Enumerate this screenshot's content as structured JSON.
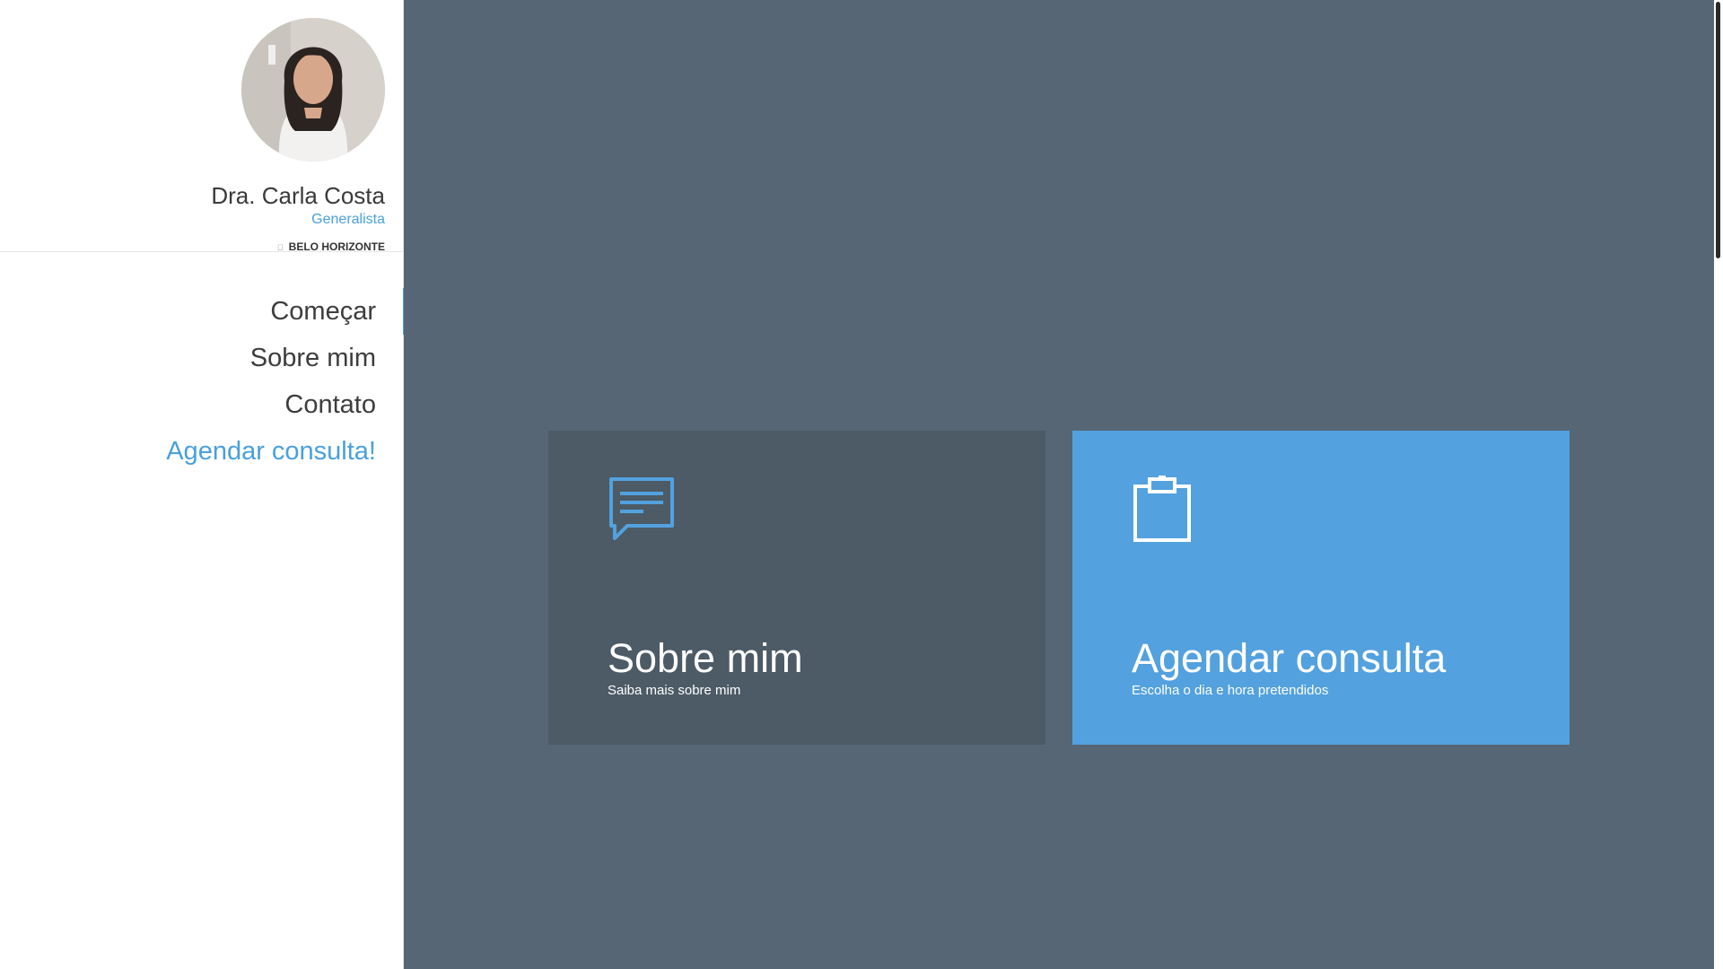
{
  "profile": {
    "name": "Dra. Carla Costa",
    "specialty": "Generalista",
    "city": "BELO HORIZONTE",
    "pin_icon": ""
  },
  "nav": {
    "items": [
      {
        "label": "Começar"
      },
      {
        "label": "Sobre mim"
      },
      {
        "label": "Contato"
      },
      {
        "label": "Agendar consulta!"
      }
    ]
  },
  "cards": {
    "about": {
      "title": "Sobre mim",
      "subtitle": "Saiba mais sobre mim",
      "icon": "chat-bubble-icon"
    },
    "book": {
      "title": "Agendar consulta",
      "subtitle": "Escolha o dia e hora pretendidos",
      "icon": "clipboard-icon"
    }
  },
  "colors": {
    "accent": "#4aa0dc",
    "main_bg": "#566674",
    "card_dark": "#4c5b66",
    "card_blue": "#53a1de"
  }
}
